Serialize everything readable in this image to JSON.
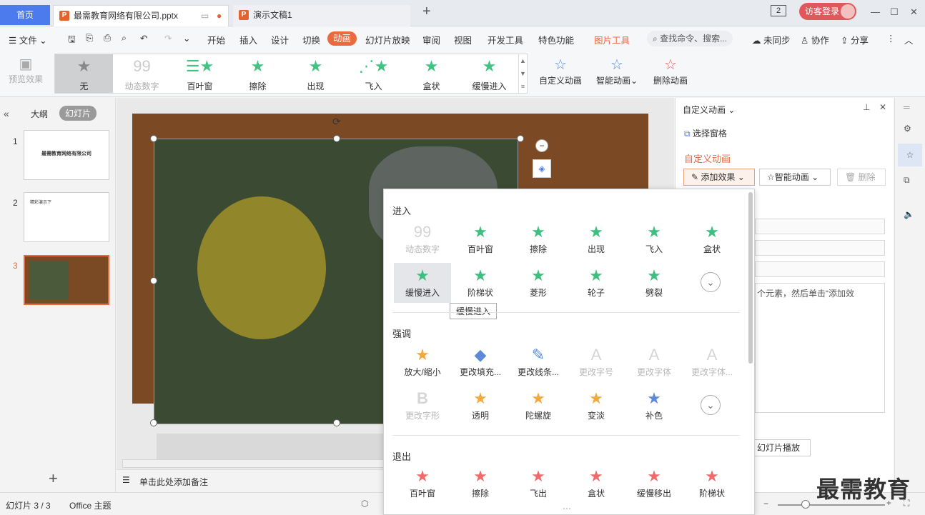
{
  "tabs": {
    "home": "首页",
    "active_doc": "最需教育网络有限公司.pptx",
    "second_doc": "演示文稿1",
    "add": "+",
    "badge": "2",
    "login": "访客登录"
  },
  "menu": {
    "file": "文件",
    "items": [
      "开始",
      "插入",
      "设计",
      "切换",
      "动画",
      "幻灯片放映",
      "审阅",
      "视图",
      "开发工具",
      "特色功能",
      "图片工具"
    ],
    "search_placeholder": "查找命令、搜索...",
    "unsync": "未同步",
    "collab": "协作",
    "share": "分享"
  },
  "ribbon": {
    "preview": "预览效果",
    "gallery": [
      "无",
      "动态数字",
      "百叶窗",
      "擦除",
      "出现",
      "飞入",
      "盒状",
      "缓慢进入"
    ],
    "custom_anim": "自定义动画",
    "smart_anim": "智能动画",
    "delete_anim": "删除动画"
  },
  "leftpane": {
    "outline": "大纲",
    "slides": "幻灯片",
    "thumb1_title": "最需教育网络有限公司",
    "thumb2_title": "精彩演示下",
    "numbers": [
      "1",
      "2",
      "3"
    ]
  },
  "canvas": {
    "notes": "单击此处添加备注"
  },
  "rightpane": {
    "header": "自定义动画",
    "select_pane": "选择窗格",
    "section_title": "自定义动画",
    "add_effect": "添加效果",
    "smart_anim": "智能动画",
    "delete": "删除",
    "hint": "个元素，然后单击“添加效",
    "play": "幻灯片播放"
  },
  "dropdown": {
    "enter_title": "进入",
    "emphasis_title": "强调",
    "exit_title": "退出",
    "enter_row1": [
      "动态数字",
      "百叶窗",
      "擦除",
      "出现",
      "飞入",
      "盒状"
    ],
    "enter_row2": [
      "缓慢进入",
      "阶梯状",
      "菱形",
      "轮子",
      "劈裂"
    ],
    "tooltip": "缓慢进入",
    "emph_row1": [
      "放大/缩小",
      "更改填充...",
      "更改线条...",
      "更改字号",
      "更改字体",
      "更改字体..."
    ],
    "emph_row2": [
      "更改字形",
      "透明",
      "陀螺旋",
      "变淡",
      "补色"
    ],
    "exit_row1": [
      "百叶窗",
      "擦除",
      "飞出",
      "盒状",
      "缓慢移出",
      "阶梯状"
    ]
  },
  "status": {
    "slide_info": "幻灯片 3 / 3",
    "theme": "Office 主题"
  },
  "watermark": "最需教育",
  "colors": {
    "accent_orange": "#e86a3f",
    "home_blue": "#4b7bec",
    "effect_green": "#3fbf7f"
  }
}
